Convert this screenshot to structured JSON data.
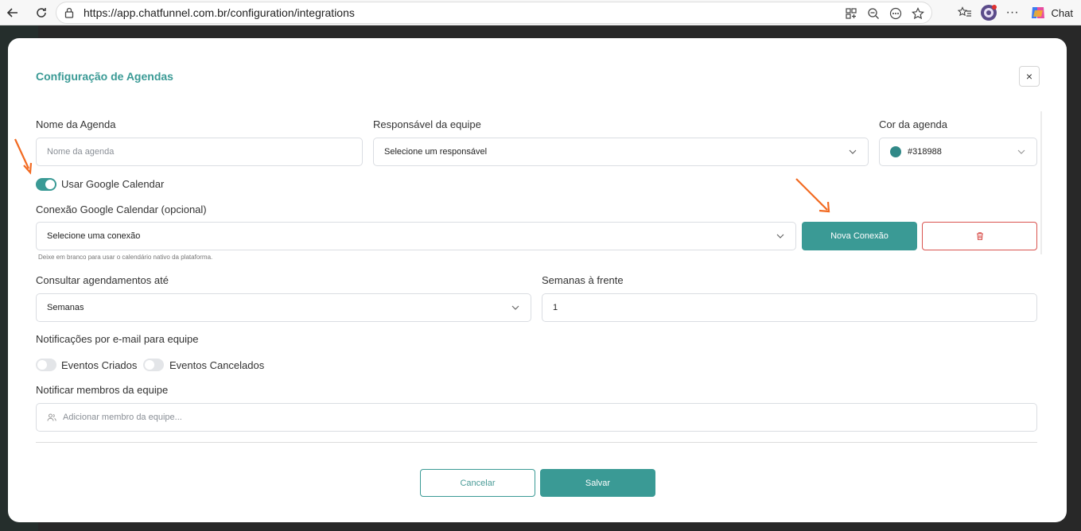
{
  "browser": {
    "url": "https://app.chatfunnel.com.br/configuration/integrations",
    "chat_label": "Chat"
  },
  "modal": {
    "title": "Configuração de Agendas",
    "close_symbol": "×",
    "agenda_name": {
      "label": "Nome da Agenda",
      "placeholder": "Nome da agenda"
    },
    "responsible": {
      "label": "Responsável da equipe",
      "value": "Selecione um responsável"
    },
    "color": {
      "label": "Cor da agenda",
      "value": "#318988",
      "swatch": "#318988"
    },
    "google_toggle": {
      "label": "Usar Google Calendar",
      "on": true
    },
    "connection": {
      "label": "Conexão Google Calendar (opcional)",
      "value": "Selecione uma conexão",
      "hint": "Deixe em branco para usar o calendário nativo da plataforma.",
      "new_button": "Nova Conexão"
    },
    "lookup": {
      "label": "Consultar agendamentos até",
      "value": "Semanas"
    },
    "weeks_ahead": {
      "label": "Semanas à frente",
      "value": "1"
    },
    "email_notifications": {
      "label": "Notificações por e-mail para equipe",
      "created": "Eventos Criados",
      "cancelled": "Eventos Cancelados"
    },
    "notify_members": {
      "label": "Notificar membros da equipe",
      "placeholder": "Adicionar membro da equipe..."
    },
    "cancel_button": "Cancelar",
    "save_button": "Salvar"
  },
  "colors": {
    "accent": "#3a9a95",
    "danger": "#d9534f",
    "annotation_arrow": "#f26a21"
  }
}
